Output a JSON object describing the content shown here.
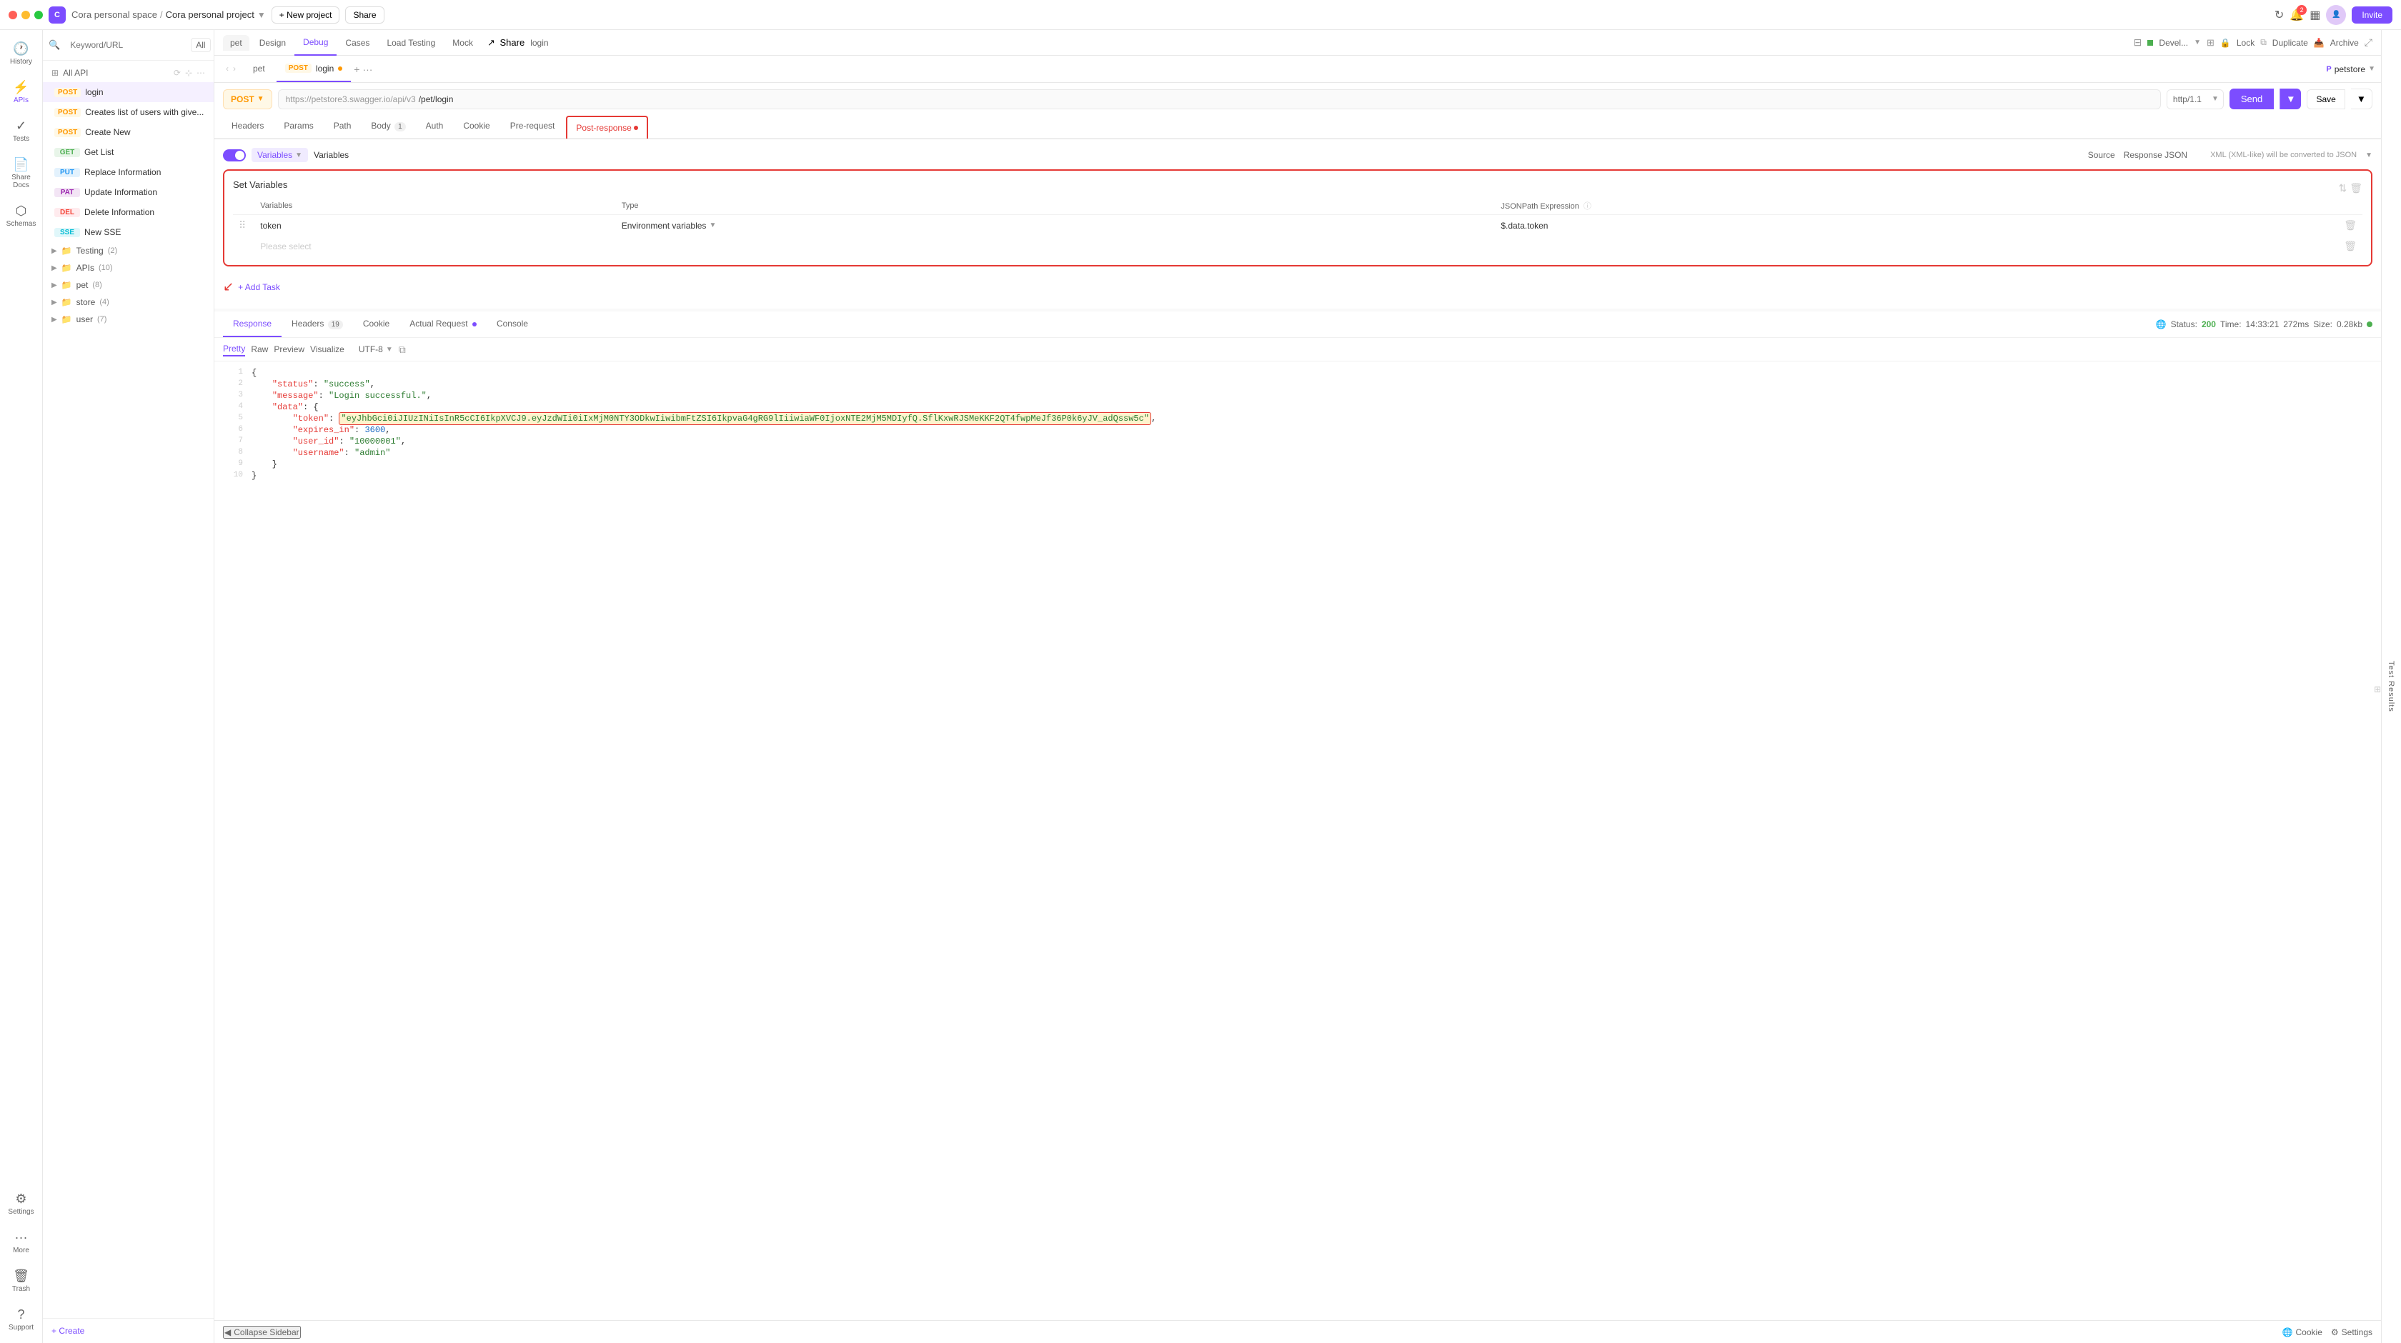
{
  "app": {
    "title": "Cora",
    "workspace": "Cora personal space",
    "project": "Cora personal project",
    "new_project_label": "+ New project",
    "share_label": "Share",
    "invite_label": "Invite",
    "notification_count": "2"
  },
  "nav": {
    "items": [
      {
        "id": "history",
        "label": "History",
        "icon": "🕐"
      },
      {
        "id": "apis",
        "label": "APIs",
        "icon": "⚡"
      },
      {
        "id": "tests",
        "label": "Tests",
        "icon": "✓"
      },
      {
        "id": "share_docs",
        "label": "Share Docs",
        "icon": "📄"
      },
      {
        "id": "schemas",
        "label": "Schemas",
        "icon": "⬡"
      },
      {
        "id": "settings",
        "label": "Settings",
        "icon": "⚙"
      },
      {
        "id": "more",
        "label": "More",
        "icon": "···"
      },
      {
        "id": "trash",
        "label": "Trash",
        "icon": "🗑"
      },
      {
        "id": "support",
        "label": "Support",
        "icon": "?"
      }
    ]
  },
  "api_sidebar": {
    "search_placeholder": "Keyword/URL",
    "filter_label": "All",
    "all_api_label": "All API",
    "create_label": "+ Create",
    "items": [
      {
        "method": "POST",
        "name": "login",
        "active": true
      },
      {
        "method": "POST",
        "name": "Creates list of users with give..."
      },
      {
        "method": "POST",
        "name": "Create New"
      },
      {
        "method": "GET",
        "name": "Get List"
      },
      {
        "method": "PUT",
        "name": "Replace Information"
      },
      {
        "method": "PAT",
        "name": "Update Information"
      },
      {
        "method": "DEL",
        "name": "Delete Information"
      },
      {
        "method": "SSE",
        "name": "New SSE"
      }
    ],
    "folders": [
      {
        "name": "Testing",
        "count": 2
      },
      {
        "name": "APIs",
        "count": 10
      },
      {
        "name": "pet",
        "count": 8
      },
      {
        "name": "store",
        "count": 4
      },
      {
        "name": "user",
        "count": 7
      }
    ]
  },
  "tabs": [
    {
      "id": "pet",
      "label": "pet"
    },
    {
      "id": "login",
      "label": "POST login",
      "has_dot": true,
      "active": true
    }
  ],
  "env_bar": {
    "env_label": "P petstore",
    "arrow": "▼"
  },
  "request": {
    "method": "POST",
    "url_base": "https://petstore3.swagger.io/api/v3",
    "url_path": "/pet/login",
    "http_version": "http/1.1",
    "send_label": "Send",
    "save_label": "Save"
  },
  "request_tabs": {
    "items": [
      "Headers",
      "Params",
      "Path",
      "Body (1)",
      "Auth",
      "Cookie",
      "Pre-request",
      "Post-response"
    ],
    "active": "Post-response"
  },
  "top_nav_tabs": {
    "items": [
      "Design",
      "Debug",
      "Cases",
      "Load Testing",
      "Mock"
    ],
    "active": "Debug",
    "share_label": "Share",
    "login_label": "login"
  },
  "top_right_actions": {
    "lock_label": "Lock",
    "duplicate_label": "Duplicate",
    "archive_label": "Archive"
  },
  "post_response": {
    "toggle_on": true,
    "toggle_label": "Variables",
    "variables_label": "Variables",
    "source_tab": "Source",
    "response_json_tab": "Response JSON",
    "xml_label": "XML (XML-like) will be converted to JSON",
    "set_variables_title": "Set Variables",
    "table_headers": [
      "Variables",
      "Type",
      "JSONPath Expression"
    ],
    "rows": [
      {
        "name": "token",
        "type": "Environment variables",
        "json_path": "$.data.token"
      }
    ],
    "placeholder_row": "Please select"
  },
  "add_task": {
    "label": "+ Add Task"
  },
  "response": {
    "tabs": [
      "Response",
      "Headers (19)",
      "Cookie",
      "Actual Request •",
      "Console"
    ],
    "active_tab": "Response",
    "status": "200",
    "time": "14:33:21",
    "duration": "272ms",
    "size": "0.28kb",
    "format_tabs": [
      "Pretty",
      "Raw",
      "Preview",
      "Visualize"
    ],
    "active_format": "Pretty",
    "encoding": "UTF-8",
    "body_lines": [
      {
        "num": 1,
        "content": "{"
      },
      {
        "num": 2,
        "content": "    \"status\": \"success\","
      },
      {
        "num": 3,
        "content": "    \"message\": \"Login successful.\","
      },
      {
        "num": 4,
        "content": "    \"data\": {"
      },
      {
        "num": 5,
        "content": "        \"token\": \"eyJhbGci0iJIUzINiIsInR5cCI6IkpXVCJ9.eyJzdWIi0iIxMjM0NTY3ODkwIiwibmFtZSI6IkpvaG4gRG9lIiiwiaWF0IjoxNTE2MjM5MDIyfQ.SflKxwRJSMeKKF2QT4fwpMeJf36P0k6yJV_adQssw5c\","
      },
      {
        "num": 6,
        "content": "        \"expires_in\": 3600,"
      },
      {
        "num": 7,
        "content": "        \"user_id\": \"10000001\","
      },
      {
        "num": 8,
        "content": "        \"username\": \"admin\""
      },
      {
        "num": 9,
        "content": "    }"
      },
      {
        "num": 10,
        "content": "}"
      }
    ]
  },
  "bottom_bar": {
    "collapse_label": "Collapse Sidebar",
    "cookie_label": "Cookie",
    "settings_label": "Settings"
  },
  "test_results_label": "Test Results"
}
